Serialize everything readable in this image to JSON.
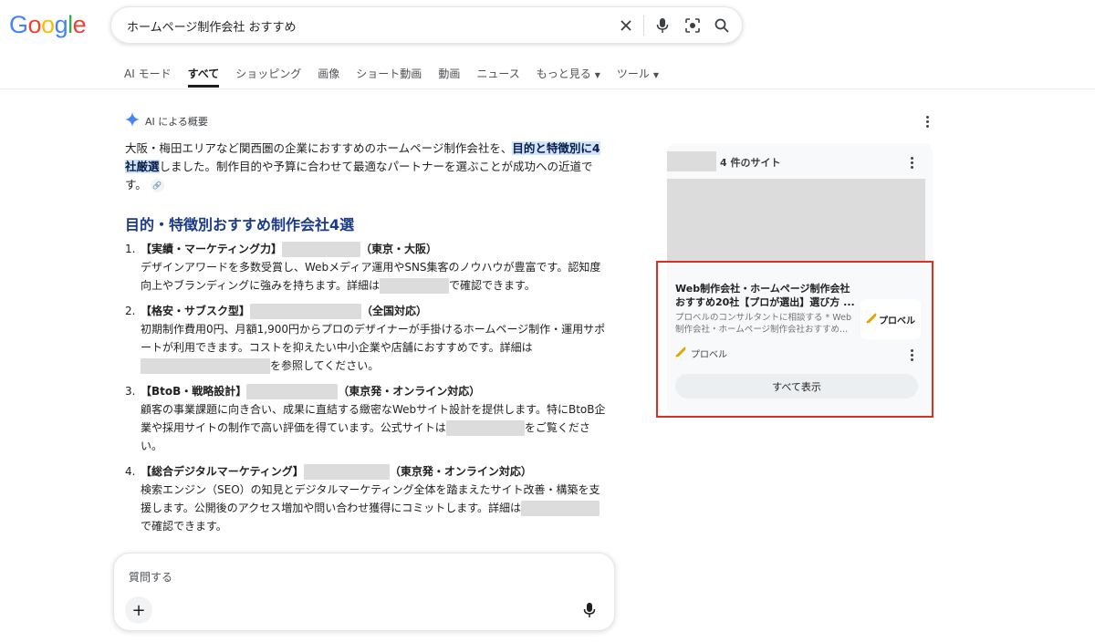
{
  "logo": {
    "letters": [
      "G",
      "o",
      "o",
      "g",
      "l",
      "e"
    ],
    "colors": [
      "#4285F4",
      "#EA4335",
      "#FBBC05",
      "#4285F4",
      "#34A853",
      "#EA4335"
    ]
  },
  "search": {
    "query": "ホームページ制作会社 おすすめ",
    "icons": [
      "close-icon",
      "mic-icon",
      "lens-icon",
      "search-icon"
    ]
  },
  "tabs": [
    {
      "label": "AI モード"
    },
    {
      "label": "すべて",
      "active": true
    },
    {
      "label": "ショッピング"
    },
    {
      "label": "画像"
    },
    {
      "label": "ショート動画"
    },
    {
      "label": "動画"
    },
    {
      "label": "ニュース"
    },
    {
      "label": "もっと見る",
      "dropdown": true
    },
    {
      "label": "ツール",
      "dropdown": true
    }
  ],
  "ai_overview": {
    "label": "AI による概要",
    "intro_1": "大阪・梅田エリアなど関西圏の企業におすすめのホームページ制作会社を、",
    "intro_hl": "目的と特徴別に4社厳選",
    "intro_2": "しました。制作目的や予算に合わせて最適なパートナーを選ぶことが成功への近道です。",
    "heading": "目的・特徴別おすすめ制作会社4選",
    "items": [
      {
        "num": "1.",
        "title": "【実績・マーケティング力】",
        "tag": "（東京・大阪）",
        "line1": "デザインアワードを多数受賞し、Webメディア運用やSNS集客のノウハウが豊富です。認知度向上やブランディングに強みを持ちます。詳細は",
        "line2": "で確認できます。"
      },
      {
        "num": "2.",
        "title": "【格安・サブスク型】",
        "tag": "（全国対応）",
        "line1": "初期制作費用0円、月額1,900円からプロのデザイナーが手掛けるホームページ制作・運用サポートが利用できます。コストを抑えたい中小企業や店舗におすすめです。詳細は",
        "line2": "を参照してください。"
      },
      {
        "num": "3.",
        "title": "【BtoB・戦略設計】",
        "tag": "（東京発・オンライン対応）",
        "line1": "顧客の事業課題に向き合い、成果に直結する緻密なWebサイト設計を提供します。特にBtoB企業や採用サイトの制作で高い評価を得ています。公式サイトは",
        "line2": "をご覧ください。"
      },
      {
        "num": "4.",
        "title": "【総合デジタルマーケティング】",
        "tag": "（東京発・オンライン対応）",
        "line1": "検索エンジン（SEO）の知見とデジタルマーケティング全体を踏まえたサイト改善・構築を支援します。公開後のアクセス増加や問い合わせ獲得にコミットします。詳細は",
        "line2": "で確認できます。"
      }
    ]
  },
  "ask": {
    "placeholder": "質問する",
    "plus": "+"
  },
  "sources": {
    "count_label": "4 件のサイト",
    "card_title": "Web制作会社・ホームページ制作会社おすすめ20社【プロが選出】選び方 ...",
    "card_desc": "プロベルのコンサルタントに相談する * Web制作会社・ホームページ制作会社おすすめ...",
    "logo_text": "プロベル",
    "source_name": "プロベル",
    "show_all": "すべて表示"
  }
}
